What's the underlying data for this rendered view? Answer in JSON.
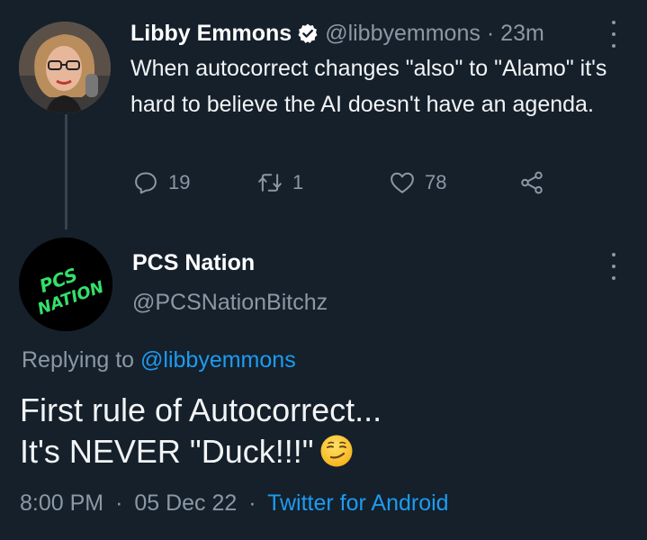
{
  "tweet": {
    "author_name": "Libby Emmons",
    "handle": "@libbyemmons",
    "separator": "·",
    "time_ago": "23m",
    "text": "When autocorrect changes \"also\" to \"Alamo\" it's hard to believe the AI doesn't have an agenda.",
    "reply_count": "19",
    "retweet_count": "1",
    "like_count": "78",
    "icons": [
      "verified-badge-icon",
      "reply-icon",
      "retweet-icon",
      "like-icon",
      "share-icon",
      "more-icon"
    ]
  },
  "reply": {
    "author_name": "PCS Nation",
    "handle": "@PCSNationBitchz",
    "avatar_text": [
      "PCS",
      "NATION"
    ],
    "replying_label": "Replying to",
    "replying_handle": "@libbyemmons",
    "text_line1": "First rule of Autocorrect...",
    "text_line2": "It's NEVER \"Duck!!!\"",
    "emoji": "smirking-face-emoji",
    "time": "8:00 PM",
    "separator": "·",
    "date": "05 Dec 22",
    "source": "Twitter for Android"
  },
  "colors": {
    "background": "#15202b",
    "text": "#ffffff",
    "muted": "#8b98a5",
    "link": "#1d9bf0",
    "avatar_logo_green": "#34e06a"
  }
}
